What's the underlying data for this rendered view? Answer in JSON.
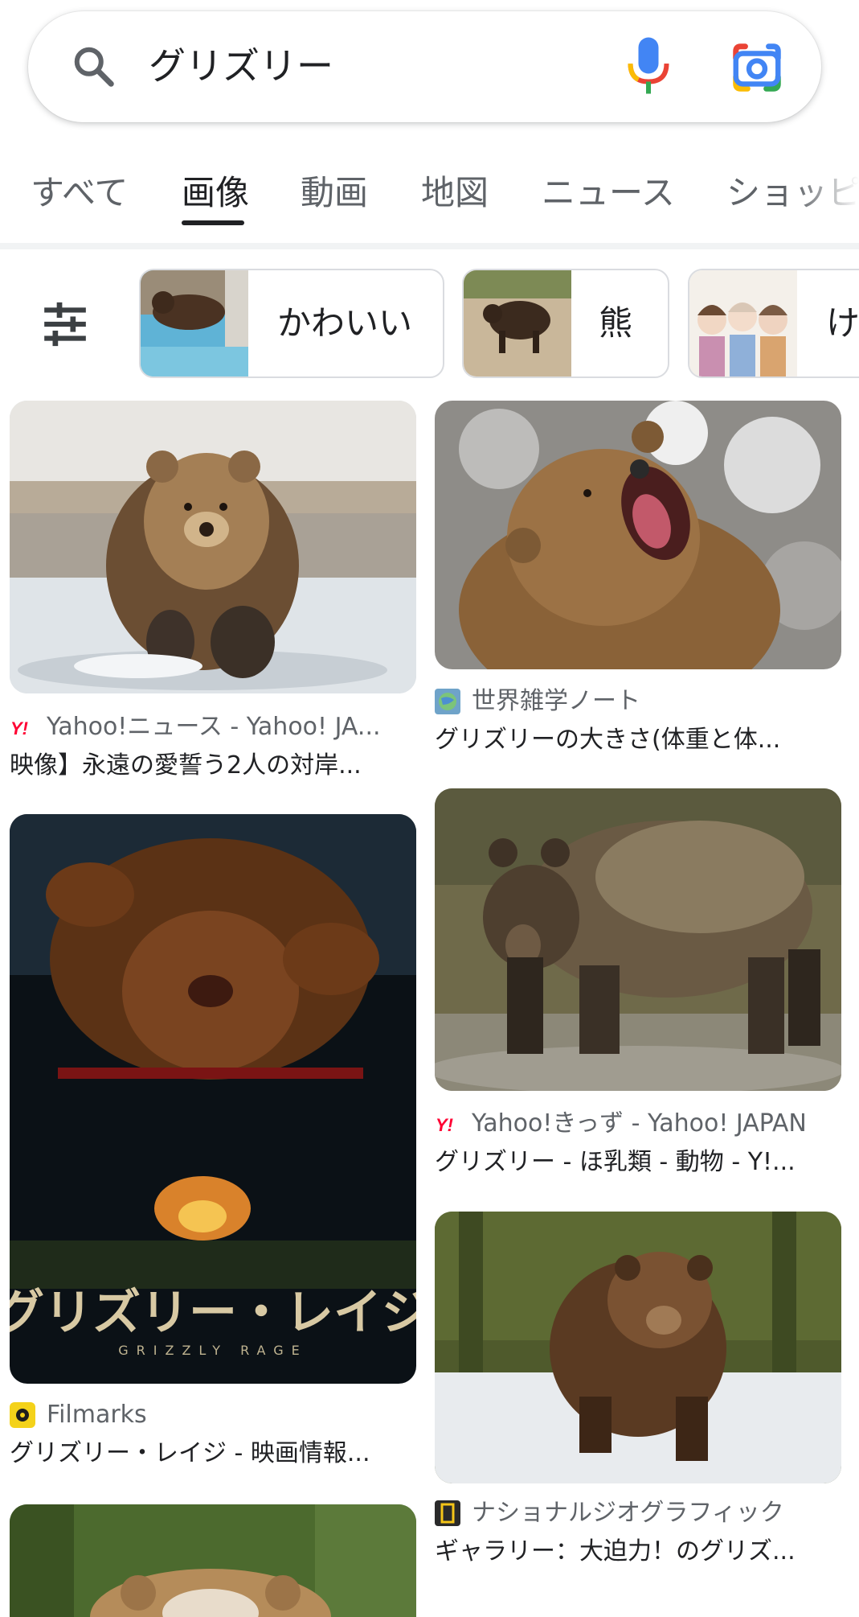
{
  "search": {
    "query": "グリズリー",
    "icons": {
      "search": "search-icon",
      "voice": "mic-icon",
      "lens": "google-lens-icon"
    }
  },
  "tabs": [
    {
      "label": "すべて",
      "active": false
    },
    {
      "label": "画像",
      "active": true
    },
    {
      "label": "動画",
      "active": false
    },
    {
      "label": "地図",
      "active": false
    },
    {
      "label": "ニュース",
      "active": false
    },
    {
      "label": "ショッピ",
      "active": false
    }
  ],
  "chips": [
    {
      "label": "かわいい"
    },
    {
      "label": "熊"
    },
    {
      "label": "け"
    }
  ],
  "results": [
    {
      "source": "Yahoo!ニュース - Yahoo! JA...",
      "title": "映像】永遠の愛誓う2人の対岸...",
      "favicon": "yahoo-icon"
    },
    {
      "source": "世界雑学ノート",
      "title": "グリズリーの大きさ(体重と体...",
      "favicon": "globe-icon"
    },
    {
      "source": "Filmarks",
      "title": "グリズリー・レイジ - 映画情報...",
      "favicon": "filmarks-icon"
    },
    {
      "source": "Yahoo!きっず - Yahoo! JAPAN",
      "title": "グリズリー - ほ乳類 - 動物 - Y!...",
      "favicon": "yahoo-icon"
    },
    {
      "source": "ナショナルジオグラフィック",
      "title": "ギャラリー：大迫力！のグリズ...",
      "favicon": "national-geographic-icon"
    }
  ],
  "poster": {
    "title_text": "グリズリー・レイジ",
    "subtitle_text": "GRIZZLY RAGE"
  },
  "colors": {
    "text_primary": "#202124",
    "text_secondary": "#5f6368",
    "chip_border": "#dadce0",
    "yahoo_red": "#ff0033"
  }
}
